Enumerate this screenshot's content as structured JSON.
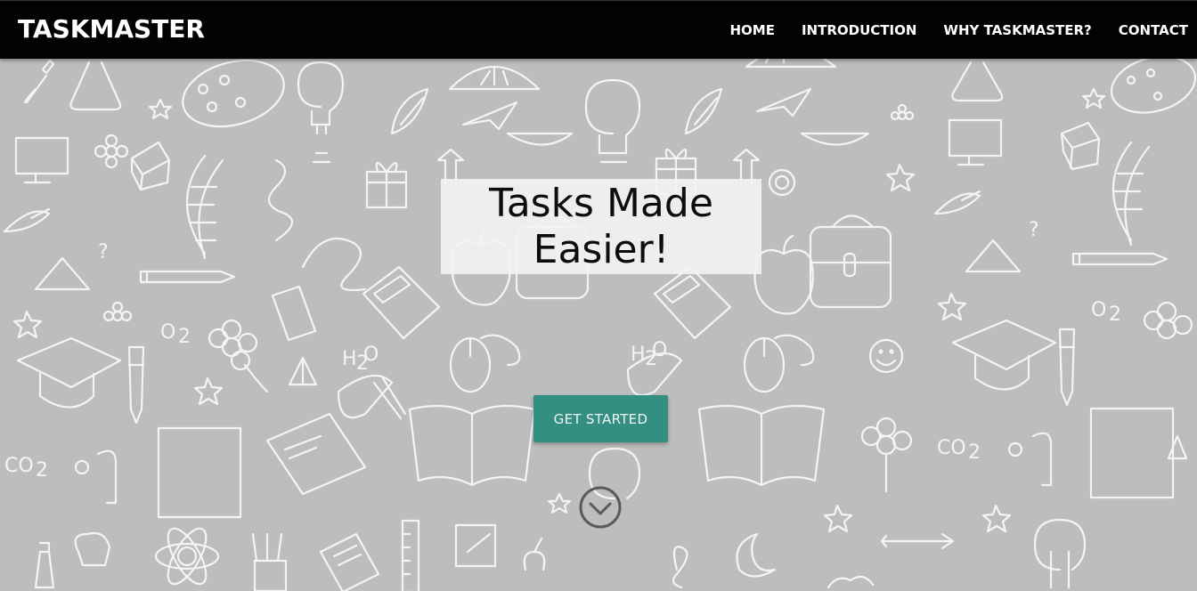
{
  "navbar": {
    "brand": "TASKMASTER",
    "links": [
      {
        "label": "HOME"
      },
      {
        "label": "INTRODUCTION"
      },
      {
        "label": "WHY TASKMASTER?"
      },
      {
        "label": "CONTACT"
      }
    ]
  },
  "hero": {
    "title_line1": "Tasks Made",
    "title_line2": "Easier!",
    "cta_label": "GET STARTED",
    "scroll_icon": "chevron-down-circle-icon"
  },
  "colors": {
    "navbar_bg": "#020202",
    "page_bg": "#bdbdbd",
    "doodle_stroke": "#f4f4f4",
    "cta_bg": "#328f82",
    "title_box_bg": "#f2f2f2"
  }
}
